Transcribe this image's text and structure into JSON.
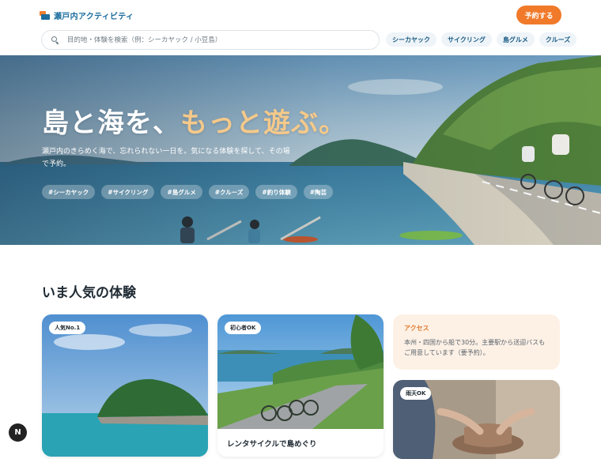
{
  "header": {
    "brand": "瀬戸内アクティビティ",
    "reserve_label": "予約する"
  },
  "search": {
    "placeholder": "目的地・体験を検索（例：シーカヤック / 小豆島）"
  },
  "quick_chips": [
    "シーカヤック",
    "サイクリング",
    "島グルメ",
    "クルーズ"
  ],
  "hero": {
    "title_part1": "島と海を、",
    "title_part2": "もっと遊ぶ。",
    "subtitle": "瀬戸内のきらめく海で、忘れられない一日を。気になる体験を探して、その場で予約。",
    "tags": [
      "#シーカヤック",
      "#サイクリング",
      "#島グルメ",
      "#クルーズ",
      "#釣り体験",
      "#陶芸"
    ]
  },
  "popular": {
    "title": "いま人気の体験",
    "cards": [
      {
        "badge": "人気No.1",
        "title": ""
      },
      {
        "badge": "初心者OK",
        "title": "レンタサイクルで島めぐり"
      },
      {
        "badge": "雨天OK",
        "title": ""
      }
    ]
  },
  "access": {
    "title": "アクセス",
    "text": "本州・四国から船で30分。主要駅から送迎バスもご用意しています（要予約）。"
  },
  "fab_label": "N",
  "colors": {
    "brand": "#1b6d9e",
    "accent": "#f07a2a",
    "hero_accent": "#f5c98a"
  },
  "icons": [
    "search-icon",
    "logo-icon"
  ]
}
